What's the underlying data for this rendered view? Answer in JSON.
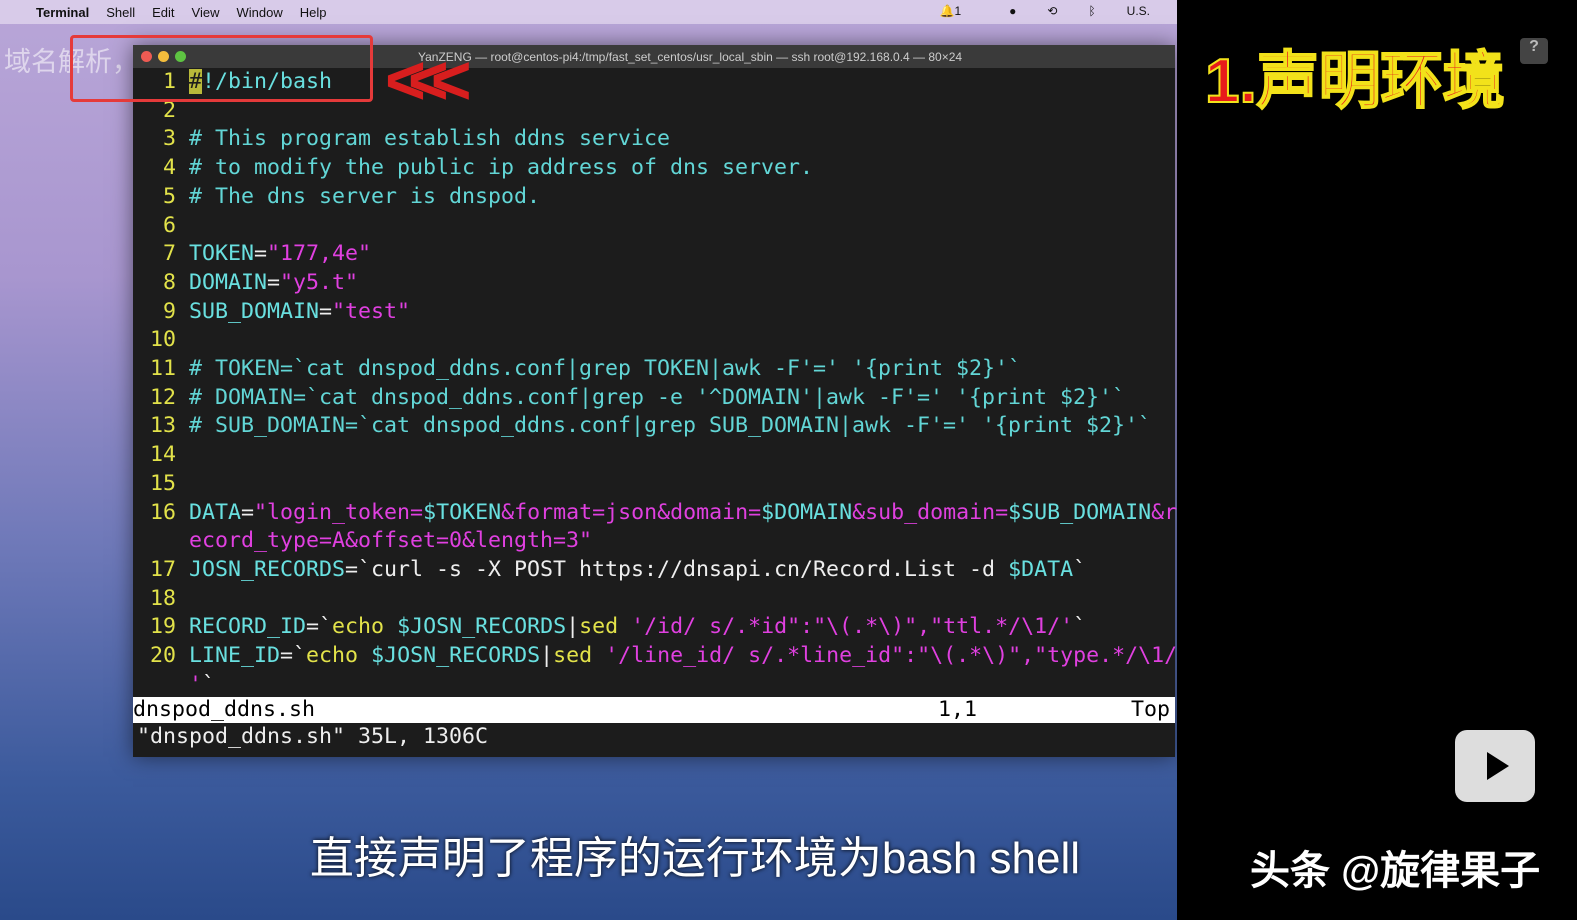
{
  "menubar": {
    "app": "Terminal",
    "items": [
      "Shell",
      "Edit",
      "View",
      "Window",
      "Help"
    ],
    "tray": [
      "1",
      "U.S."
    ]
  },
  "overlay_text": "域名解析，外网远程访问",
  "window": {
    "title": "YanZENG — root@centos-pi4:/tmp/fast_set_centos/usr_local_sbin — ssh root@192.168.0.4 — 80×24"
  },
  "code_lines": [
    {
      "n": "1",
      "segs": [
        [
          "cur",
          "#"
        ],
        [
          "v",
          "!/bin/bash"
        ]
      ]
    },
    {
      "n": "2",
      "segs": []
    },
    {
      "n": "3",
      "segs": [
        [
          "c",
          "# This program establish ddns service"
        ]
      ]
    },
    {
      "n": "4",
      "segs": [
        [
          "c",
          "# to modify the public ip address of dns server."
        ]
      ]
    },
    {
      "n": "5",
      "segs": [
        [
          "c",
          "# The dns server is dnspod."
        ]
      ]
    },
    {
      "n": "6",
      "segs": []
    },
    {
      "n": "7",
      "segs": [
        [
          "v",
          "TOKEN"
        ],
        [
          "w",
          "="
        ],
        [
          "s",
          "\"177,4e\""
        ]
      ]
    },
    {
      "n": "8",
      "segs": [
        [
          "v",
          "DOMAIN"
        ],
        [
          "w",
          "="
        ],
        [
          "s",
          "\"y5.t\""
        ]
      ]
    },
    {
      "n": "9",
      "segs": [
        [
          "v",
          "SUB_DOMAIN"
        ],
        [
          "w",
          "="
        ],
        [
          "s",
          "\"test\""
        ]
      ]
    },
    {
      "n": "10",
      "segs": []
    },
    {
      "n": "11",
      "segs": [
        [
          "c",
          "# TOKEN=`cat dnspod_ddns.conf|grep TOKEN|awk -F'=' '{print $2}'`"
        ]
      ]
    },
    {
      "n": "12",
      "segs": [
        [
          "c",
          "# DOMAIN=`cat dnspod_ddns.conf|grep -e '^DOMAIN'|awk -F'=' '{print $2}'`"
        ]
      ]
    },
    {
      "n": "13",
      "segs": [
        [
          "c",
          "# SUB_DOMAIN=`cat dnspod_ddns.conf|grep SUB_DOMAIN|awk -F'=' '{print $2}'`"
        ]
      ]
    },
    {
      "n": "14",
      "segs": []
    },
    {
      "n": "15",
      "segs": []
    },
    {
      "n": "16",
      "segs": [
        [
          "v",
          "DATA"
        ],
        [
          "w",
          "="
        ],
        [
          "s",
          "\"login_token="
        ],
        [
          "v",
          "$TOKEN"
        ],
        [
          "s",
          "&format=json&domain="
        ],
        [
          "v",
          "$DOMAIN"
        ],
        [
          "s",
          "&sub_domain="
        ],
        [
          "v",
          "$SUB_DOMAIN"
        ],
        [
          "s",
          "&r"
        ]
      ]
    },
    {
      "n": "",
      "segs": [
        [
          "s",
          "ecord_type=A&offset=0&length=3\""
        ]
      ]
    },
    {
      "n": "17",
      "segs": [
        [
          "v",
          "JOSN_RECORDS"
        ],
        [
          "w",
          "=`curl -s -X POST https://dnsapi.cn/Record.List -d "
        ],
        [
          "v",
          "$DATA"
        ],
        [
          "w",
          "`"
        ]
      ]
    },
    {
      "n": "18",
      "segs": []
    },
    {
      "n": "19",
      "segs": [
        [
          "v",
          "RECORD_ID"
        ],
        [
          "w",
          "=`"
        ],
        [
          "y",
          "echo "
        ],
        [
          "v",
          "$JOSN_RECORDS"
        ],
        [
          "w",
          "|"
        ],
        [
          "y",
          "sed "
        ],
        [
          "s",
          "'/id/ s/.*id\":\"\\(.*\\)\",\"ttl.*/\\1/'"
        ],
        [
          "w",
          "`"
        ]
      ]
    },
    {
      "n": "20",
      "segs": [
        [
          "v",
          "LINE_ID"
        ],
        [
          "w",
          "=`"
        ],
        [
          "y",
          "echo "
        ],
        [
          "v",
          "$JOSN_RECORDS"
        ],
        [
          "w",
          "|"
        ],
        [
          "y",
          "sed "
        ],
        [
          "s",
          "'/line_id/ s/.*line_id\":\"\\(.*\\)\",\"type.*/\\1/"
        ]
      ]
    },
    {
      "n": "",
      "segs": [
        [
          "s",
          "'"
        ],
        [
          "w",
          "`"
        ]
      ]
    }
  ],
  "status": {
    "file": "dnspod_ddns.sh",
    "pos": "1,1",
    "scroll": "Top"
  },
  "message": "\"dnspod_ddns.sh\" 35L, 1306C",
  "banner": "1.声明环境",
  "help": "?",
  "subtitle": "直接声明了程序的运行环境为bash shell",
  "watermark": "头条 @旋律果子"
}
